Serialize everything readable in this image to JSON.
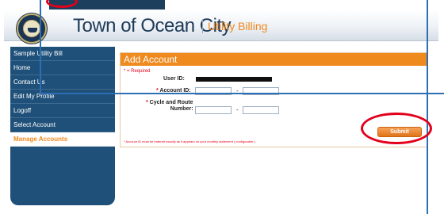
{
  "header": {
    "town_name": "Town of Ocean City",
    "subtitle": "Utility Billing"
  },
  "sidebar": {
    "items": [
      {
        "label": "Sample Utility Bill"
      },
      {
        "label": "Home"
      },
      {
        "label": "Contact Us"
      },
      {
        "label": "Edit My Profile"
      },
      {
        "label": "Logoff"
      },
      {
        "label": "Select Account"
      },
      {
        "label": "Manage Accounts"
      }
    ]
  },
  "form": {
    "title": "Add Account",
    "required_note": "* = Required",
    "user_id_label": "User ID:",
    "account_id_label": "Account ID:",
    "cycle_label_line1": "Cycle and Route",
    "cycle_label_line2": "Number:",
    "dash": "-",
    "note": "* Account ID must be entered exactly as it appears on your monthly statement ( configurable ).",
    "submit_label": "Submit"
  },
  "colors": {
    "brand_navy": "#1f5079",
    "accent_orange": "#ef8a1f",
    "required_red": "#e3001b",
    "annotation_blue": "#2c6fb5"
  }
}
